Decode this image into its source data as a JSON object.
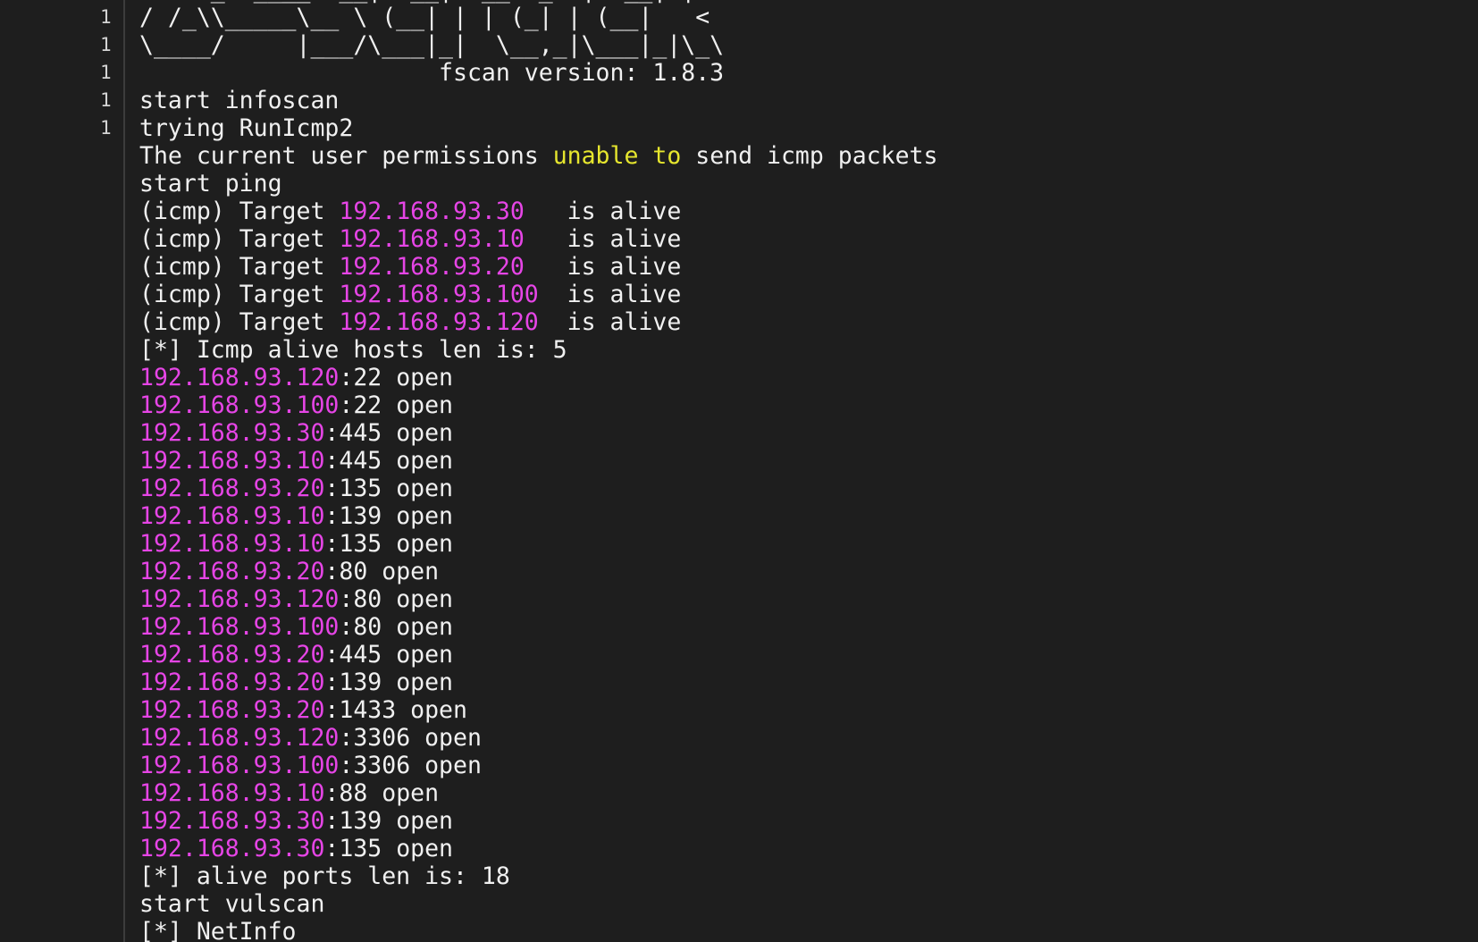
{
  "colors": {
    "background": "#1e1e1e",
    "default_text": "#f0f0f0",
    "ip_highlight": "#e645e6",
    "warning_highlight": "#e6e62e"
  },
  "gutter": {
    "numbers": [
      "1",
      "1",
      "1",
      "1",
      "1"
    ]
  },
  "terminal": {
    "lines": [
      [
        {
          "t": "  / /_\\/____/ __|/ __|  __/ _` |/ __| |/ /",
          "c": "default"
        }
      ],
      [
        {
          "t": "/ /_\\\\_____\\__ \\ (__| | | (_| | (__|   <",
          "c": "default"
        }
      ],
      [
        {
          "t": "\\____/     |___/\\___|_|  \\__,_|\\___|_|\\_\\",
          "c": "default"
        }
      ],
      [
        {
          "t": "                     fscan version: 1.8.3",
          "c": "default"
        }
      ],
      [
        {
          "t": "start infoscan",
          "c": "default"
        }
      ],
      [
        {
          "t": "trying RunIcmp2",
          "c": "default"
        }
      ],
      [
        {
          "t": "The current user permissions ",
          "c": "default"
        },
        {
          "t": "unable to",
          "c": "warn"
        },
        {
          "t": " send icmp packets",
          "c": "default"
        }
      ],
      [
        {
          "t": "start ping",
          "c": "default"
        }
      ],
      [
        {
          "t": "(icmp) Target ",
          "c": "default"
        },
        {
          "t": "192.168.93.30",
          "c": "ip"
        },
        {
          "t": "   is alive",
          "c": "default"
        }
      ],
      [
        {
          "t": "(icmp) Target ",
          "c": "default"
        },
        {
          "t": "192.168.93.10",
          "c": "ip"
        },
        {
          "t": "   is alive",
          "c": "default"
        }
      ],
      [
        {
          "t": "(icmp) Target ",
          "c": "default"
        },
        {
          "t": "192.168.93.20",
          "c": "ip"
        },
        {
          "t": "   is alive",
          "c": "default"
        }
      ],
      [
        {
          "t": "(icmp) Target ",
          "c": "default"
        },
        {
          "t": "192.168.93.100",
          "c": "ip"
        },
        {
          "t": "  is alive",
          "c": "default"
        }
      ],
      [
        {
          "t": "(icmp) Target ",
          "c": "default"
        },
        {
          "t": "192.168.93.120",
          "c": "ip"
        },
        {
          "t": "  is alive",
          "c": "default"
        }
      ],
      [
        {
          "t": "[*] Icmp alive hosts len is: 5",
          "c": "default"
        }
      ],
      [
        {
          "t": "192.168.93.120",
          "c": "ip"
        },
        {
          "t": ":22 open",
          "c": "default"
        }
      ],
      [
        {
          "t": "192.168.93.100",
          "c": "ip"
        },
        {
          "t": ":22 open",
          "c": "default"
        }
      ],
      [
        {
          "t": "192.168.93.30",
          "c": "ip"
        },
        {
          "t": ":445 open",
          "c": "default"
        }
      ],
      [
        {
          "t": "192.168.93.10",
          "c": "ip"
        },
        {
          "t": ":445 open",
          "c": "default"
        }
      ],
      [
        {
          "t": "192.168.93.20",
          "c": "ip"
        },
        {
          "t": ":135 open",
          "c": "default"
        }
      ],
      [
        {
          "t": "192.168.93.10",
          "c": "ip"
        },
        {
          "t": ":139 open",
          "c": "default"
        }
      ],
      [
        {
          "t": "192.168.93.10",
          "c": "ip"
        },
        {
          "t": ":135 open",
          "c": "default"
        }
      ],
      [
        {
          "t": "192.168.93.20",
          "c": "ip"
        },
        {
          "t": ":80 open",
          "c": "default"
        }
      ],
      [
        {
          "t": "192.168.93.120",
          "c": "ip"
        },
        {
          "t": ":80 open",
          "c": "default"
        }
      ],
      [
        {
          "t": "192.168.93.100",
          "c": "ip"
        },
        {
          "t": ":80 open",
          "c": "default"
        }
      ],
      [
        {
          "t": "192.168.93.20",
          "c": "ip"
        },
        {
          "t": ":445 open",
          "c": "default"
        }
      ],
      [
        {
          "t": "192.168.93.20",
          "c": "ip"
        },
        {
          "t": ":139 open",
          "c": "default"
        }
      ],
      [
        {
          "t": "192.168.93.20",
          "c": "ip"
        },
        {
          "t": ":1433 open",
          "c": "default"
        }
      ],
      [
        {
          "t": "192.168.93.120",
          "c": "ip"
        },
        {
          "t": ":3306 open",
          "c": "default"
        }
      ],
      [
        {
          "t": "192.168.93.100",
          "c": "ip"
        },
        {
          "t": ":3306 open",
          "c": "default"
        }
      ],
      [
        {
          "t": "192.168.93.10",
          "c": "ip"
        },
        {
          "t": ":88 open",
          "c": "default"
        }
      ],
      [
        {
          "t": "192.168.93.30",
          "c": "ip"
        },
        {
          "t": ":139 open",
          "c": "default"
        }
      ],
      [
        {
          "t": "192.168.93.30",
          "c": "ip"
        },
        {
          "t": ":135 open",
          "c": "default"
        }
      ],
      [
        {
          "t": "[*] alive ports len is: 18",
          "c": "default"
        }
      ],
      [
        {
          "t": "start vulscan",
          "c": "default"
        }
      ],
      [
        {
          "t": "[*] NetInfo",
          "c": "default"
        }
      ]
    ]
  }
}
